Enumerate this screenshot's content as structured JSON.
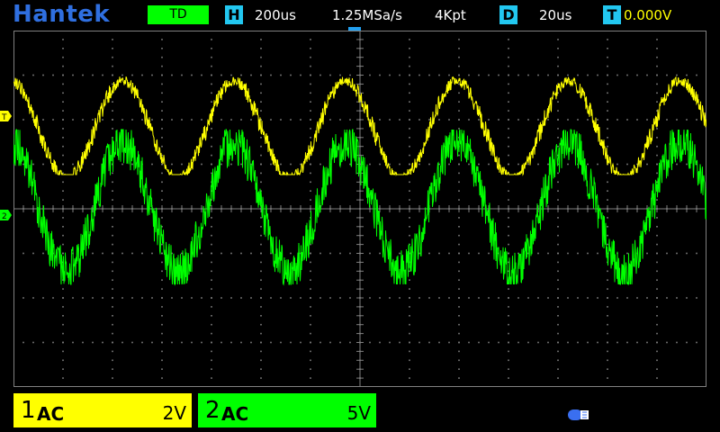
{
  "header": {
    "brand": "Hantek",
    "mode": "TD",
    "horizontal": {
      "icon": "H",
      "timebase": "200us",
      "sample_rate": "1.25MSa/s",
      "memory_depth": "4Kpt"
    },
    "delay": {
      "icon": "D",
      "value": "20us"
    },
    "trigger": {
      "icon": "T",
      "level": "0.000V"
    }
  },
  "channels": [
    {
      "number": "1",
      "coupling": "AC",
      "scale": "2V",
      "color": "#ffff00"
    },
    {
      "number": "2",
      "coupling": "AC",
      "scale": "5V",
      "color": "#00ff00"
    }
  ],
  "markers": {
    "trigger": "T",
    "ch2": "2"
  },
  "status": {
    "usb_icon": "usb-icon"
  },
  "colors": {
    "background": "#000000",
    "grid": "#808080",
    "brand": "#2f6fe0",
    "accent": "#22c7f0"
  }
}
